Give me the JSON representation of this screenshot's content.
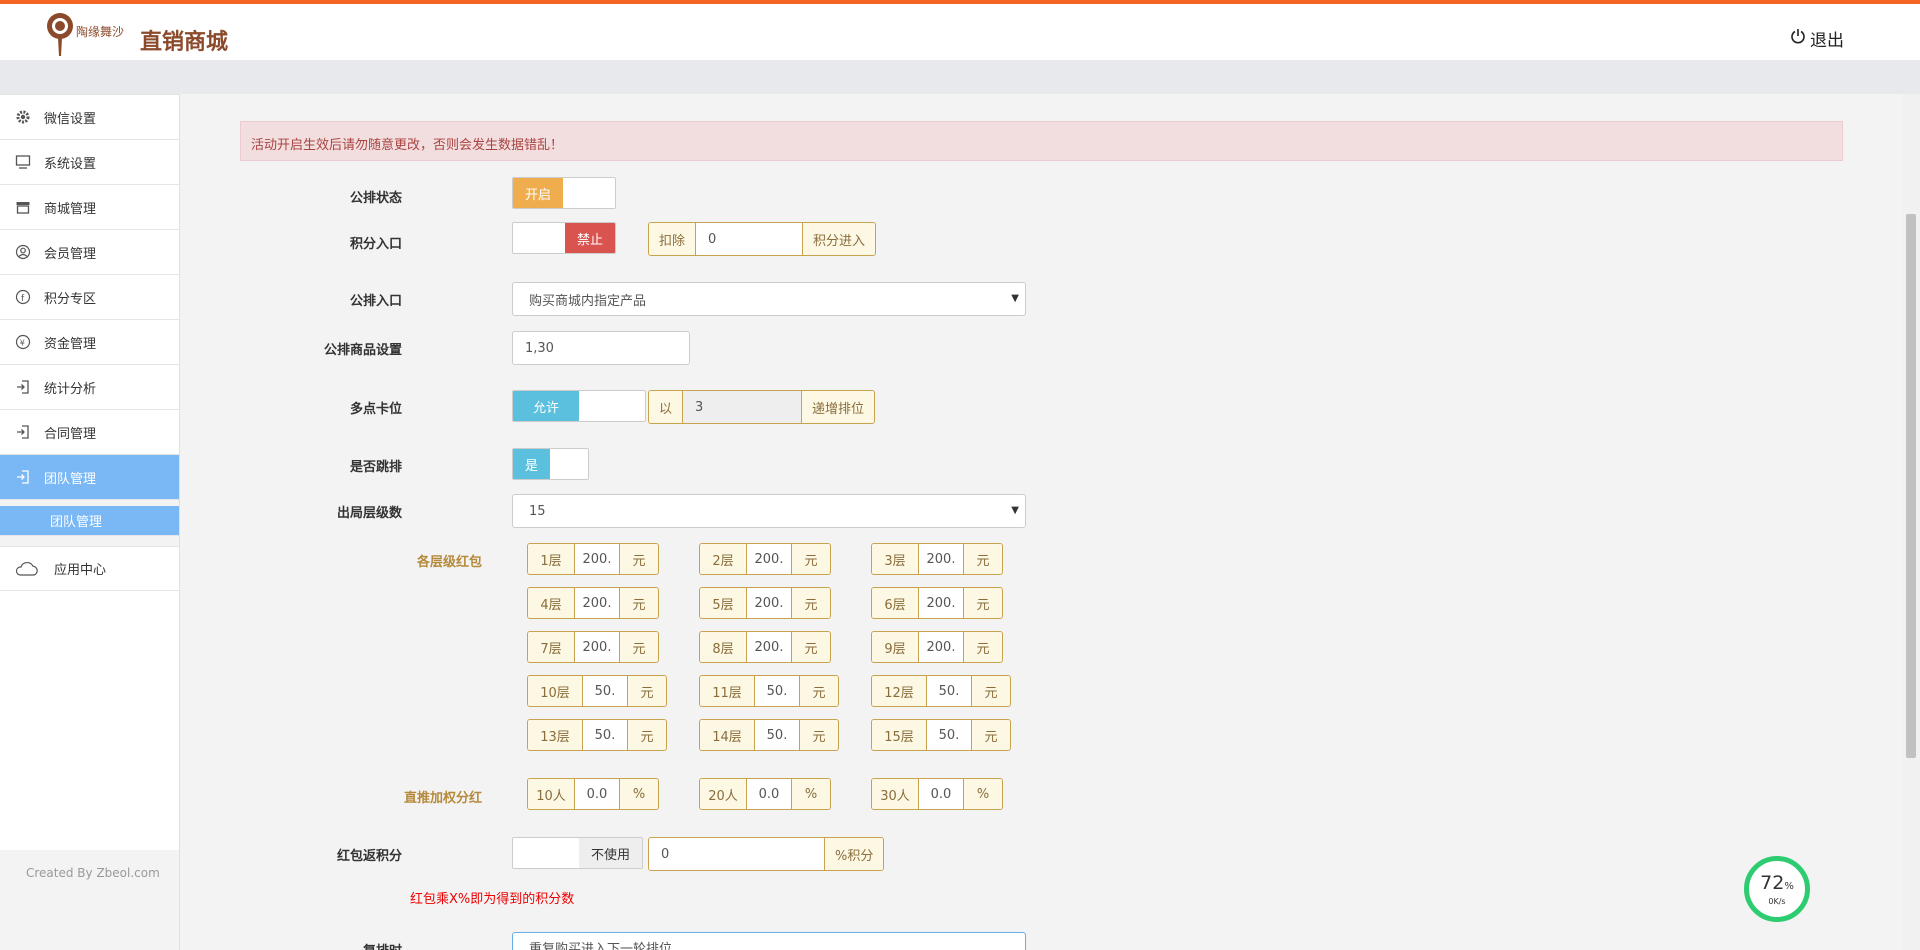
{
  "header": {
    "logo_text": "陶缘舞沙",
    "title": "直销商城",
    "logout": "退出"
  },
  "sidebar": {
    "items": [
      {
        "label": "微信设置",
        "icon": "gear-icon"
      },
      {
        "label": "系统设置",
        "icon": "monitor-icon"
      },
      {
        "label": "商城管理",
        "icon": "store-icon"
      },
      {
        "label": "会员管理",
        "icon": "user-icon"
      },
      {
        "label": "积分专区",
        "icon": "facebook-icon"
      },
      {
        "label": "资金管理",
        "icon": "yen-icon"
      },
      {
        "label": "统计分析",
        "icon": "sign-in-icon"
      },
      {
        "label": "合同管理",
        "icon": "sign-in-icon"
      },
      {
        "label": "团队管理",
        "icon": "sign-in-icon"
      }
    ],
    "sub_item": "团队管理",
    "app_center": "应用中心",
    "footer": "Created By Zbeol.com"
  },
  "alert": "活动开启生效后请勿随意更改，否则会发生数据错乱！",
  "form": {
    "public_status": {
      "label": "公排状态",
      "on": "开启"
    },
    "points_entry": {
      "label": "积分入口",
      "state": "禁止",
      "prefix": "扣除",
      "value": "0",
      "suffix": "积分进入"
    },
    "public_entry": {
      "label": "公排入口",
      "value": "购买商城内指定产品"
    },
    "product_setting": {
      "label": "公排商品设置",
      "value": "1,30"
    },
    "multi_slot": {
      "label": "多点卡位",
      "state": "允许",
      "prefix": "以",
      "value": "3",
      "suffix": "递增排位"
    },
    "jump": {
      "label": "是否跳排",
      "state": "是"
    },
    "exit_levels": {
      "label": "出局层级数",
      "value": "15"
    },
    "level_bonus": {
      "label": "各层级红包",
      "unit": "元",
      "levels": [
        {
          "name": "1层",
          "value": "200."
        },
        {
          "name": "2层",
          "value": "200."
        },
        {
          "name": "3层",
          "value": "200."
        },
        {
          "name": "4层",
          "value": "200."
        },
        {
          "name": "5层",
          "value": "200."
        },
        {
          "name": "6层",
          "value": "200."
        },
        {
          "name": "7层",
          "value": "200."
        },
        {
          "name": "8层",
          "value": "200."
        },
        {
          "name": "9层",
          "value": "200."
        },
        {
          "name": "10层",
          "value": "50."
        },
        {
          "name": "11层",
          "value": "50."
        },
        {
          "name": "12层",
          "value": "50."
        },
        {
          "name": "13层",
          "value": "50."
        },
        {
          "name": "14层",
          "value": "50."
        },
        {
          "name": "15层",
          "value": "50."
        }
      ]
    },
    "direct_bonus": {
      "label": "直推加权分红",
      "unit": "%",
      "tiers": [
        {
          "name": "10人",
          "value": "0.0"
        },
        {
          "name": "20人",
          "value": "0.0"
        },
        {
          "name": "30人",
          "value": "0.0"
        }
      ]
    },
    "redpack_points": {
      "label": "红包返积分",
      "state": "不使用",
      "value": "0",
      "suffix": "%积分"
    },
    "note": "红包乘X%即为得到的积分数",
    "rearrange": {
      "label": "复排时",
      "value": "重复购买进入下一轮排位"
    }
  },
  "speed": {
    "percent": "72",
    "unit": "%",
    "rate": "0K/s"
  }
}
